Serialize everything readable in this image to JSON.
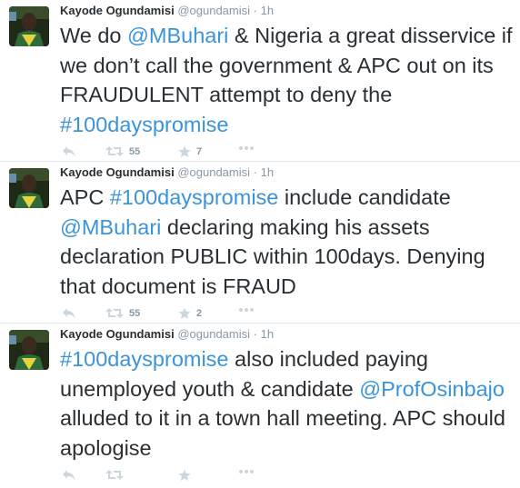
{
  "tweets": [
    {
      "author": {
        "name": "Kayode Ogundamisi",
        "handle": "@ogundamisi"
      },
      "separator": "·",
      "time": "1h",
      "text": [
        {
          "t": "We do  ",
          "link": false
        },
        {
          "t": "@MBuhari",
          "link": true
        },
        {
          "t": " & Nigeria a great disservice if we don’t call the government & APC out on its FRAUDULENT attempt to deny the ",
          "link": false
        },
        {
          "t": "#100dayspromise",
          "link": true
        }
      ],
      "retweets": "55",
      "favorites": "7"
    },
    {
      "author": {
        "name": "Kayode Ogundamisi",
        "handle": "@ogundamisi"
      },
      "separator": "·",
      "time": "1h",
      "text": [
        {
          "t": "APC ",
          "link": false
        },
        {
          "t": "#100dayspromise",
          "link": true
        },
        {
          "t": " include candidate ",
          "link": false
        },
        {
          "t": "@MBuhari",
          "link": true
        },
        {
          "t": " declaring making his assets declaration PUBLIC within 100days. Denying that document is FRAUD",
          "link": false
        }
      ],
      "retweets": "55",
      "favorites": "2"
    },
    {
      "author": {
        "name": "Kayode Ogundamisi",
        "handle": "@ogundamisi"
      },
      "separator": "·",
      "time": "1h",
      "text": [
        {
          "t": "#100dayspromise",
          "link": true
        },
        {
          "t": " also included paying unemployed youth & candidate ",
          "link": false
        },
        {
          "t": "@ProfOsinbajo",
          "link": true
        },
        {
          "t": " alluded to it in a town hall meeting. APC should apologise",
          "link": false
        }
      ],
      "retweets": "",
      "favorites": ""
    }
  ],
  "icons": {
    "reply": "reply-icon",
    "retweet": "retweet-icon",
    "favorite": "star-icon",
    "more": "more-icon"
  },
  "colors": {
    "link": "#3b94d9",
    "text": "#292f33",
    "muted": "#8899a6",
    "icon": "#ccd6dd",
    "divider": "#e1e8ed"
  }
}
